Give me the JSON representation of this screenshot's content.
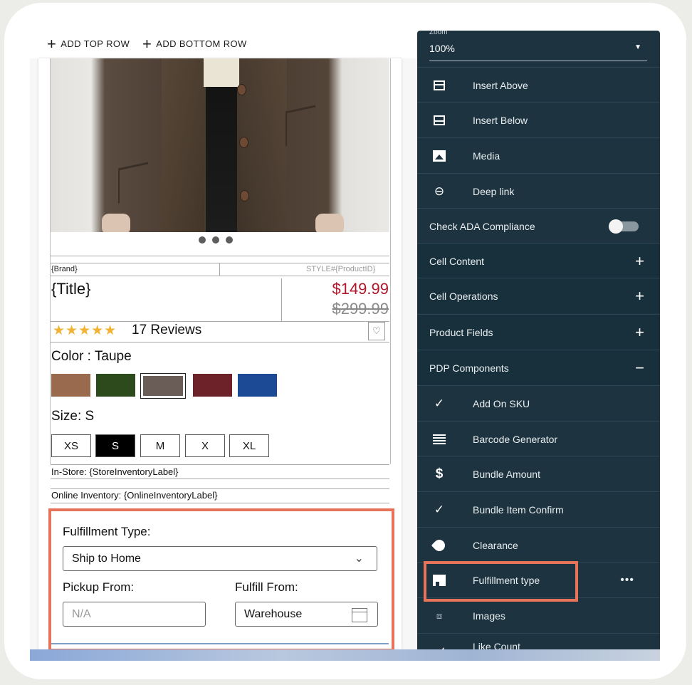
{
  "toolbar": {
    "add_top_row": "ADD TOP ROW",
    "add_bottom_row": "ADD BOTTOM ROW"
  },
  "product": {
    "brand": "{Brand}",
    "style": "STYLE#{ProductID}",
    "title": "{Title}",
    "price_now": "$149.99",
    "price_was": "$299.99",
    "rating": 4.5,
    "stars": "★★★★★",
    "reviews": "17 Reviews",
    "color_label": "Color : Taupe",
    "swatch_colors": [
      "#9a6a4f",
      "#2c4a1c",
      "#6a5c57",
      "#6d2129",
      "#1c4a95"
    ],
    "size_label": "Size: S",
    "sizes": [
      "XS",
      "S",
      "M",
      "X",
      "XL"
    ],
    "selected_size": "S",
    "store_inventory": "In-Store: {StoreInventoryLabel}",
    "online_inventory": "Online Inventory: {OnlineInventoryLabel}"
  },
  "fulfillment": {
    "type_label": "Fulfillment Type:",
    "type_value": "Ship to Home",
    "pickup_label": "Pickup From:",
    "pickup_placeholder": "N/A",
    "fulfill_label": "Fulfill From:",
    "fulfill_value": "Warehouse"
  },
  "panel": {
    "zoom_label": "Zoom",
    "zoom_value": "100%",
    "insert_above": "Insert Above",
    "insert_below": "Insert Below",
    "media": "Media",
    "deep_link": "Deep link",
    "ada": "Check ADA Compliance",
    "cell_content": "Cell Content",
    "cell_operations": "Cell Operations",
    "product_fields": "Product Fields",
    "pdp_components": "PDP Components",
    "add_on_sku": "Add On SKU",
    "barcode": "Barcode Generator",
    "bundle_amount": "Bundle Amount",
    "bundle_confirm": "Bundle Item Confirm",
    "clearance": "Clearance",
    "fulfillment_type": "Fulfillment type",
    "images": "Images",
    "like_count": "Like Count"
  },
  "colors": {
    "panel_bg": "#1d333f",
    "highlight": "#e8735b",
    "price_red": "#b0172a",
    "star": "#f2b233"
  }
}
